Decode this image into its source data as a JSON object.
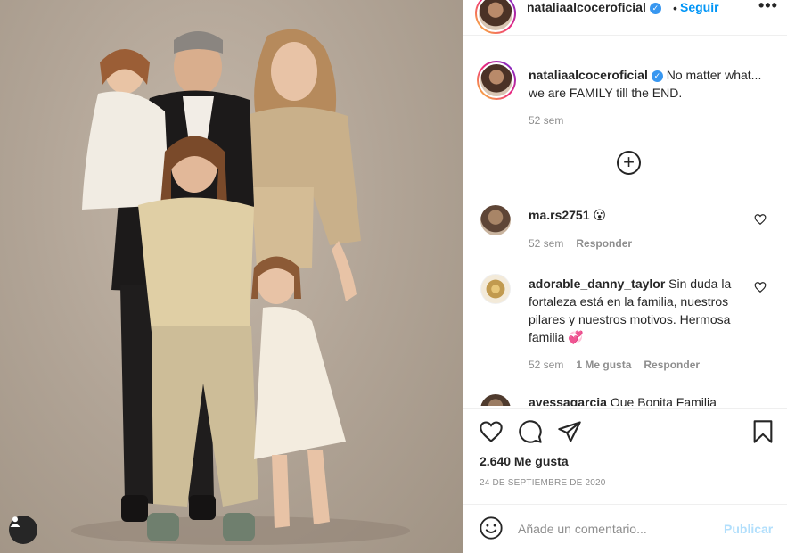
{
  "post": {
    "username": "nataliaalcoceroficial",
    "follow_label": "Seguir",
    "more_label": "•••",
    "caption": "No matter what... we are FAMILY till the END.",
    "caption_time": "52 sem",
    "load_more_symbol": "+"
  },
  "comments": [
    {
      "username": "ma.rs2751",
      "text": " 😮",
      "time": "52 sem",
      "likes": "",
      "reply": "Responder"
    },
    {
      "username": "adorable_danny_taylor",
      "text": " Sin duda la fortaleza está en la familia, nuestros pilares y nuestros motivos. Hermosa familia 💞",
      "time": "52 sem",
      "likes": "1 Me gusta",
      "reply": "Responder"
    },
    {
      "username": "ayessagarcia",
      "text": " Que Bonita Familia"
    }
  ],
  "actions": {
    "like_count": "2.640 Me gusta",
    "date": "24 de septiembre de 2020"
  },
  "add_comment": {
    "placeholder": "Añade un comentario...",
    "publish_label": "Publicar"
  },
  "icons": {
    "verified": "verified-badge-icon",
    "tagged_user": "user-tag-icon",
    "load_more": "plus-circle-icon",
    "like": "heart-icon",
    "comment": "speech-bubble-icon",
    "share": "paper-plane-icon",
    "save": "bookmark-icon",
    "emoji": "smiley-icon"
  },
  "colors": {
    "link_blue": "#0095f6",
    "verified_blue": "#3897f0",
    "muted_text": "#8e8e8e",
    "publish_disabled": "#b2dffc",
    "photo_backdrop": "#b1a496"
  }
}
